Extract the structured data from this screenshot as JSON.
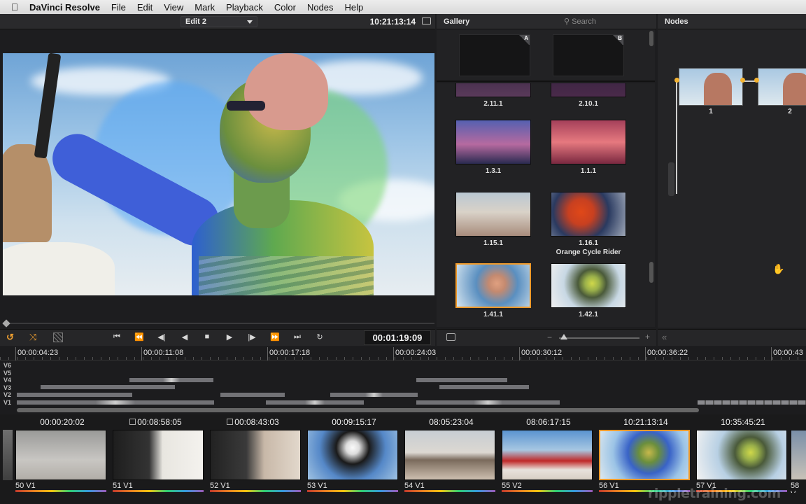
{
  "menubar": {
    "app": "DaVinci Resolve",
    "items": [
      "File",
      "Edit",
      "View",
      "Mark",
      "Playback",
      "Color",
      "Nodes",
      "Help"
    ]
  },
  "viewer": {
    "edit_name": "Edit 2",
    "record_timecode": "10:21:13:14",
    "source_timecode": "00:01:19:09"
  },
  "gallery": {
    "title": "Gallery",
    "search_placeholder": "Search",
    "slots": [
      "A",
      "B"
    ],
    "stills": [
      {
        "label": "2.11.1",
        "sub": ""
      },
      {
        "label": "2.10.1",
        "sub": ""
      },
      {
        "label": "1.3.1",
        "sub": ""
      },
      {
        "label": "1.1.1",
        "sub": ""
      },
      {
        "label": "1.15.1",
        "sub": ""
      },
      {
        "label": "1.16.1",
        "sub": "Orange Cycle Rider"
      },
      {
        "label": "1.41.1",
        "sub": ""
      },
      {
        "label": "1.42.1",
        "sub": ""
      }
    ]
  },
  "nodes": {
    "title": "Nodes",
    "items": [
      {
        "label": "1"
      },
      {
        "label": "2"
      }
    ]
  },
  "timeline": {
    "ruler": [
      "00:00:04:23",
      "00:00:11:08",
      "00:00:17:18",
      "00:00:24:03",
      "00:00:30:12",
      "00:00:36:22",
      "00:00:43"
    ],
    "tracks": [
      "V6",
      "V5",
      "V4",
      "V3",
      "V2",
      "V1"
    ]
  },
  "strip": [
    {
      "tc": "00:00:20:02",
      "name": "50 V1"
    },
    {
      "tc": "00:08:58:05",
      "name": "51 V1"
    },
    {
      "tc": "00:08:43:03",
      "name": "52 V1"
    },
    {
      "tc": "00:09:15:17",
      "name": "53 V1"
    },
    {
      "tc": "08:05:23:04",
      "name": "54 V1"
    },
    {
      "tc": "08:06:17:15",
      "name": "55 V2"
    },
    {
      "tc": "10:21:13:14",
      "name": "56 V1"
    },
    {
      "tc": "10:35:45:21",
      "name": "57 V1"
    },
    {
      "tc": "",
      "name": "58 V"
    }
  ],
  "watermark": "rippletraining.com",
  "colors": {
    "accent": "#f09a2a",
    "panel": "#1d1d1f"
  }
}
